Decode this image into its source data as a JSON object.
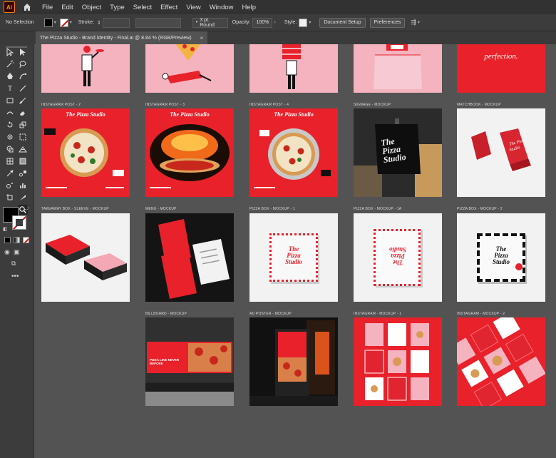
{
  "menubar": {
    "items": [
      "File",
      "Edit",
      "Object",
      "Type",
      "Select",
      "Effect",
      "View",
      "Window",
      "Help"
    ]
  },
  "controlbar": {
    "selection": "No Selection",
    "stroke_label": "Stroke:",
    "stroke_profile": "3 pt. Round",
    "opacity_label": "Opacity:",
    "opacity_value": "100%",
    "style_label": "Style:",
    "document_setup": "Document Setup",
    "preferences": "Preferences"
  },
  "tab": {
    "title": "The Pizza Studio - Brand Identity - Final.ai @ 8.84 % (RGB/Preview)",
    "close": "×"
  },
  "artboards": {
    "row2": [
      "INSTAGRAM POST - 2",
      "INSTAGRAM POST - 3",
      "INSTAGRAM POST - 4",
      "SIGNAGE - MOCKUP",
      "MATCHBOOK - MOCKUP"
    ],
    "row3": [
      "TAKEAWAY BOX - SLEEVE - MOCKUP",
      "MENU - MOCKUP",
      "PIZZA BOX - MOCKUP - 1",
      "PIZZA BOX - MOCKUP - 1A",
      "PIZZA BOX - MOCKUP - 2"
    ],
    "row4": [
      "BILLBOARD - MOCKUP",
      "AD POSTER - MOCKUP",
      "INSTAGRAM - MOCKUP - 1",
      "INSTAGRAM - MOCKUP - 2"
    ]
  },
  "artwork_text": {
    "perfection": "perfection.",
    "brand": "The Pizza Studio",
    "brand_line1": "The",
    "brand_line2": "Pizza",
    "brand_line3": "Studio",
    "billboard_headline": "PIZZA LIKE NEVER BEFORE"
  },
  "colors": {
    "brand_red": "#e8212b",
    "brand_pink": "#f4b3bf",
    "ui_dark": "#323232",
    "canvas": "#535353"
  }
}
